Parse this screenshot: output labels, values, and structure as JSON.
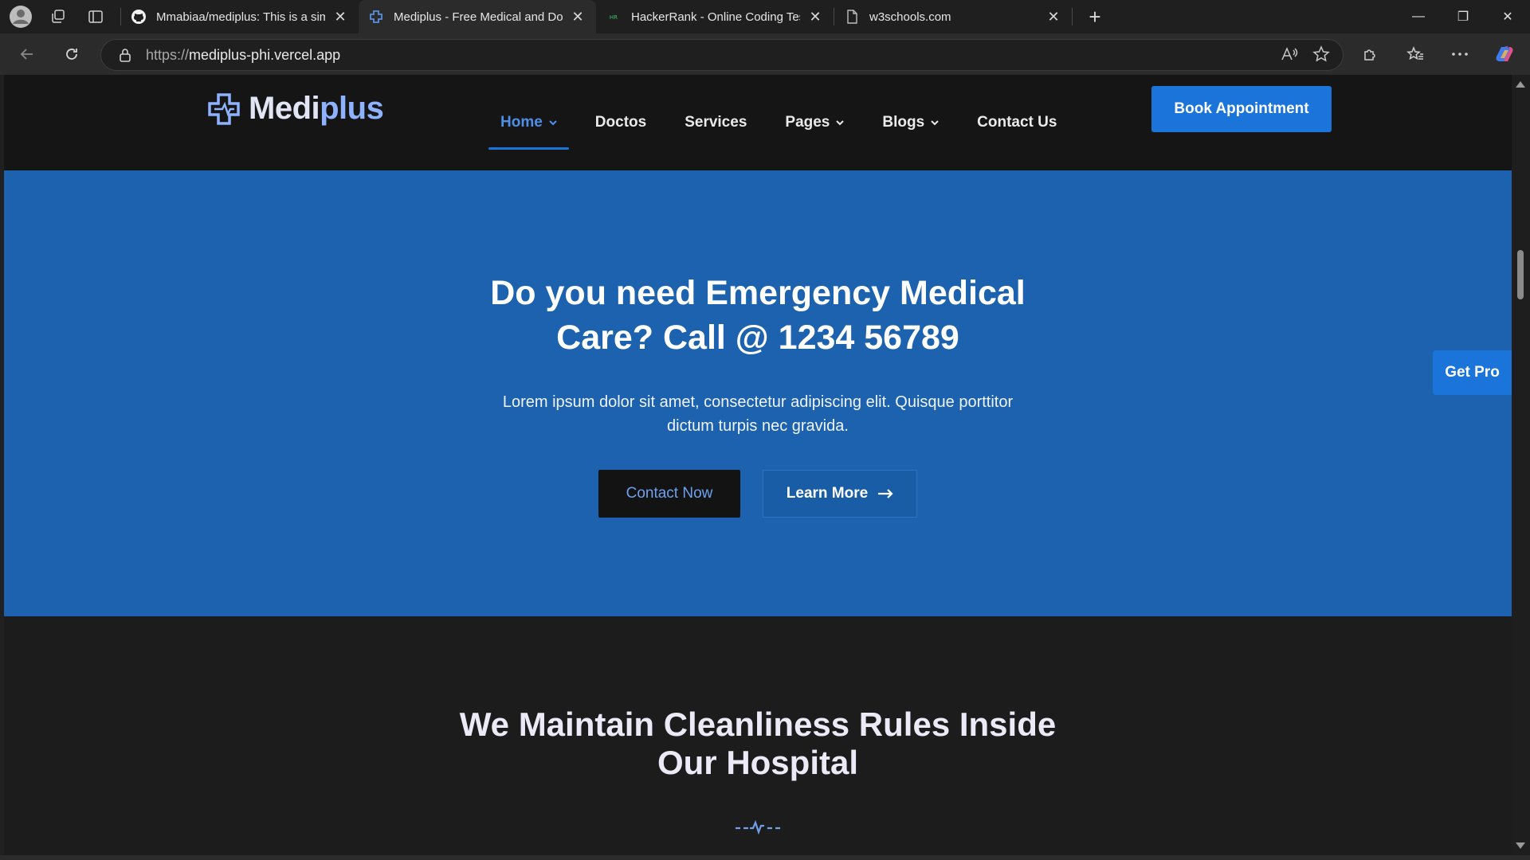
{
  "browser": {
    "tabs": [
      {
        "title": "Mmabiaa/mediplus: This is a simp",
        "icon": "github-icon",
        "active": false
      },
      {
        "title": "Mediplus - Free Medical and Doct",
        "icon": "mediplus-favicon",
        "active": true
      },
      {
        "title": "HackerRank - Online Coding Tests",
        "icon": "hackerrank-icon",
        "active": false
      },
      {
        "title": "w3schools.com",
        "icon": "page-icon",
        "active": false
      }
    ],
    "url_protocol": "https://",
    "url_host": "mediplus-phi.vercel.app"
  },
  "site": {
    "logo_main": "Medi",
    "logo_accent": "plus",
    "nav": [
      {
        "label": "Home",
        "dropdown": true,
        "active": true
      },
      {
        "label": "Doctos",
        "dropdown": false,
        "active": false
      },
      {
        "label": "Services",
        "dropdown": false,
        "active": false
      },
      {
        "label": "Pages",
        "dropdown": true,
        "active": false
      },
      {
        "label": "Blogs",
        "dropdown": true,
        "active": false
      },
      {
        "label": "Contact Us",
        "dropdown": false,
        "active": false
      }
    ],
    "book_button": "Book Appointment",
    "get_pro": "Get Pro"
  },
  "hero": {
    "title_line1": "Do you need Emergency Medical",
    "title_line2": "Care? Call @ 1234 56789",
    "text_line1": "Lorem ipsum dolor sit amet, consectetur adipiscing elit. Quisque porttitor",
    "text_line2": "dictum turpis nec gravida.",
    "contact_button": "Contact Now",
    "learn_button": "Learn More"
  },
  "section2": {
    "title_line1": "We Maintain Cleanliness Rules Inside",
    "title_line2": "Our Hospital"
  },
  "colors": {
    "brand_blue": "#1b74d9",
    "hero_bg": "#1c62ae",
    "header_bg": "#151515",
    "page_bg": "#1c1c1c"
  }
}
